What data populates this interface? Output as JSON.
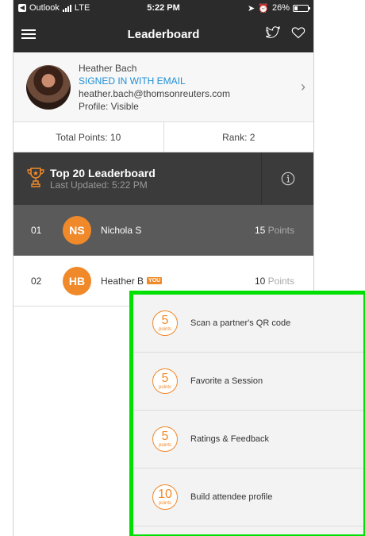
{
  "status_bar": {
    "carrier": "Outlook",
    "network": "LTE",
    "time": "5:22 PM",
    "battery": "26%",
    "battery_level": 0.26
  },
  "nav": {
    "title": "Leaderboard"
  },
  "profile": {
    "name": "Heather Bach",
    "signin_status": "SIGNED IN WITH EMAIL",
    "email": "heather.bach@thomsonreuters.com",
    "visibility": "Profile: Visible"
  },
  "stats": {
    "total_points": "Total Points: 10",
    "rank": "Rank: 2"
  },
  "leaderboard": {
    "title": "Top 20 Leaderboard",
    "last_updated": "Last Updated: 5:22 PM",
    "points_label": "Points",
    "you_badge": "YOU",
    "entries": [
      {
        "rank": "01",
        "initials": "NS",
        "name": "Nichola S",
        "points": "15"
      },
      {
        "rank": "02",
        "initials": "HB",
        "name": "Heather B",
        "points": "10"
      }
    ]
  },
  "tasks": {
    "points_unit": "points",
    "items": [
      {
        "points": "5",
        "label": "Scan a partner's QR code"
      },
      {
        "points": "5",
        "label": "Favorite a Session"
      },
      {
        "points": "5",
        "label": "Ratings & Feedback"
      },
      {
        "points": "10",
        "label": "Build attendee profile"
      }
    ]
  },
  "colors": {
    "accent": "#f0892a",
    "link": "#1f8fd6",
    "highlight": "#00e000",
    "header_dark": "#2b2b2b"
  }
}
